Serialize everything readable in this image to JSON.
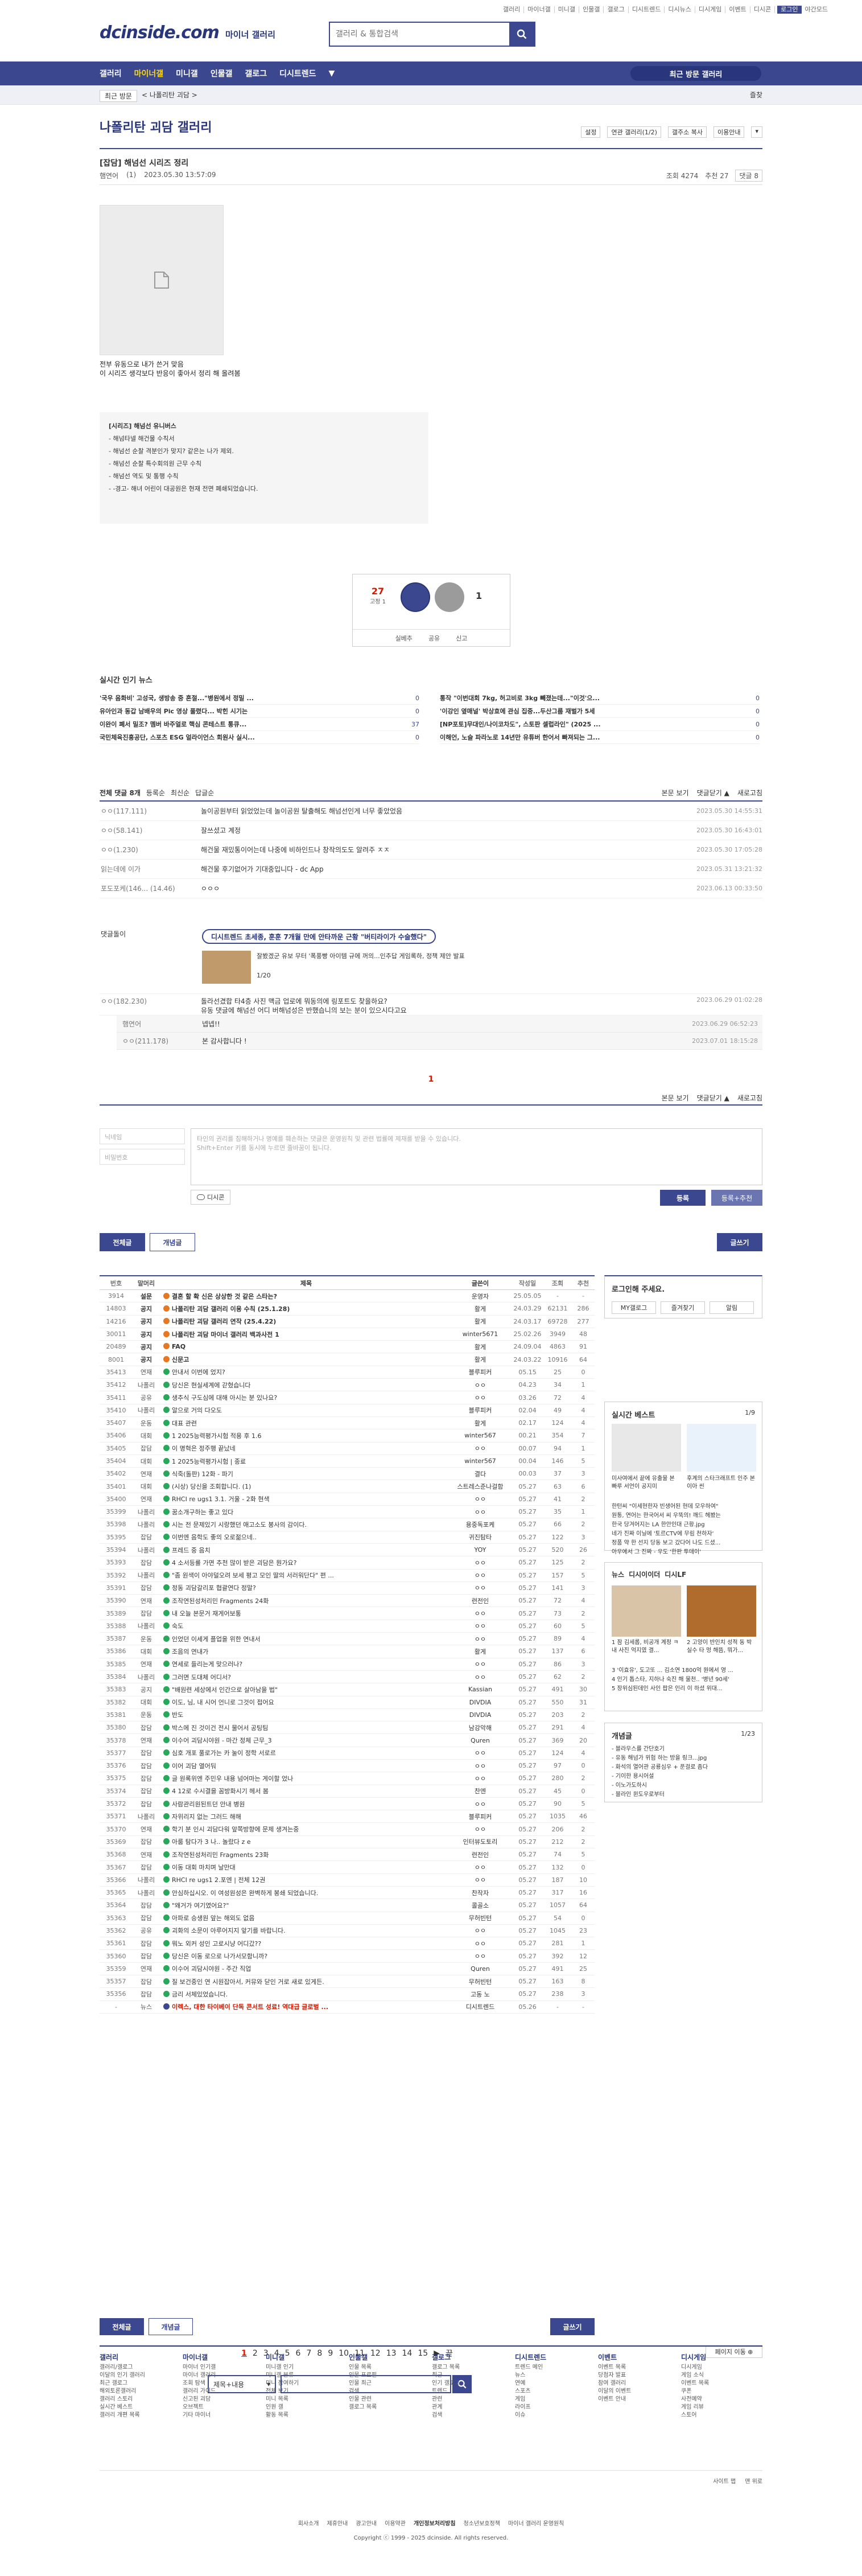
{
  "topnav": [
    "갤러리",
    "마이너갤",
    "미니갤",
    "인물갤",
    "갤로그",
    "디시트렌드",
    "디시뉴스",
    "디시게임",
    "이벤트",
    "디시콘",
    "로그인",
    "야간모드"
  ],
  "logo": {
    "brand": "dcinside.com",
    "sub": "마이너 갤러리"
  },
  "search": {
    "placeholder": "갤러리 & 통합검색"
  },
  "gnb": {
    "items": [
      "갤러리",
      "마이너갤",
      "미니갤",
      "인물갤",
      "갤로그",
      "디시트렌드"
    ],
    "active": "마이너갤",
    "more": "▼",
    "recent": "최근 방문 갤러리"
  },
  "lnb": {
    "recent": "최근 방문",
    "gallery": "< 나폴리탄 괴담 >",
    "fav": "즐찾"
  },
  "gallery": {
    "title": "나폴리탄 괴담 갤러리",
    "tools": [
      "설정",
      "연관 갤러리(1/2)",
      "갤주소 복사",
      "이용안내",
      "▾"
    ]
  },
  "post": {
    "title": "[잡담] 해넘선 시리즈 정리",
    "author": "햄연어",
    "ip": "(1)",
    "date": "2023.05.30 13:57:09",
    "views": "조회 4274",
    "comments": "추천 27",
    "cmt": "댓글 8",
    "body": [
      "전부 유동으로 내가 쓴거 맞음",
      "이 시리즈 생각보다 반응이 좋아서 정리 해 올려봄"
    ],
    "note_title": "[시리즈] 해넘선 유니버스",
    "note": [
      "- 해넘타넬 해건물 수칙서",
      "- 해넘선 순찰 격분인가 맞지? 같은는 나가 제외.",
      "- 해넘선 순찰 특수회의원 근무 수칙",
      "- 해넘선 역도 및 통행 수칙",
      "- -경고- 해녀 어린이 대공원은 현재 전면 폐쇄되었습니다."
    ]
  },
  "rec": {
    "up": "27",
    "up_sub": "고정 1",
    "up_label": "개념",
    "down_label": "비추",
    "down": "1",
    "actions": [
      "실베추",
      "공유",
      "신고"
    ]
  },
  "hot": {
    "title": "실시간 인기 뉴스",
    "left": [
      {
        "t": "'국우 음화비' 고성국, 생방송 중 혼절...\"병원에서 정밀 ...",
        "n": "0"
      },
      {
        "t": "유아인과 동갑 남배우의 Pic 영상 풀렸다... 박힌 시기는",
        "n": "0"
      },
      {
        "t": "이완이 폐서 밀조? 멤버 바주얼로 핵심 콘테스트 통큐...",
        "n": "37"
      },
      {
        "t": "국민체육진흥공단, 스포츠 ESG 얼라이언스 회원사 실시...",
        "n": "0"
      }
    ],
    "right": [
      {
        "t": "통작 \"이번대회 7kg, 허고비로 3kg 빼졌는데...\"이것'으...",
        "n": "0"
      },
      {
        "t": "'이강인 옆매널' 박상효에 관심 집중...두산그룹 재벌가 5세",
        "n": "0"
      },
      {
        "t": "[NP포토]무대인/나이코차도\", 스토판 셀럽라인\" (2025 ...",
        "n": "0"
      },
      {
        "t": "이해언, 노슬 파라노로 14년만 유튜버 한어서 빠져되는 그...",
        "n": "0"
      }
    ]
  },
  "comments": {
    "label": "전체 댓글 8개",
    "sort": [
      "등록순",
      "최신순",
      "답글순"
    ],
    "right": [
      "본문 보기",
      "댓글닫기 ▲",
      "새로고침"
    ],
    "items": [
      {
        "n": "ㅇㅇ(117.111)",
        "t": "놀이공원부터 읽었었는데 놀이공원 탈출해도 해넘선인게 너무 좋았었음",
        "d": "2023.05.30 14:55:31"
      },
      {
        "n": "ㅇㅇ(58.141)",
        "t": "잘쓰셨고 계정",
        "d": "2023.05.30 16:43:01"
      },
      {
        "n": "ㅇㅇ(1.230)",
        "t": "해건물 재밌통이어는데 나중에 비하인드나 창작의도도 알려주 ㅈㅈ",
        "d": "2023.05.30 17:05:28"
      },
      {
        "n": "읽는데에 이가",
        "t": "해건물 후기없어가 기대중입니다 - dc App",
        "d": "2023.05.31 13:21:32"
      },
      {
        "n": "포도포케(146... (14.46)",
        "t": "ㅇㅇㅇ",
        "d": "2023.06.13 00:33:50"
      }
    ]
  },
  "dccon": {
    "label": "댓글돌이",
    "pill": "디시트렌드 초세종, 훈훈 7개월 만에 안타까운 근황 \"버티라이가 수술했다\"",
    "text": [
      "잘봤겠군 유보 무터 '폭풍빵 아이템 규에 꺼의...인추답 게임록하, 정책 제안 발표"
    ],
    "page": "1/20"
  },
  "comments2": [
    {
      "n": "ㅇㅇ(182.230)",
      "t": "돌라선겼합 타4층 사진 맥금 업로에 뭐동의에 링포트도 찾을하요?",
      "t2": "유동 댓글에 해넘선 어디 버해넘성은 반했습니의 보는 분이 있으시다고요",
      "d": "2023.06.29 01:02:28"
    }
  ],
  "replies": [
    {
      "n": "햄연어",
      "t": "넵넵!!",
      "d": "2023.06.29 06:52:23"
    },
    {
      "n": "ㅇㅇ(211.178)",
      "t": "본 감사합니다 !",
      "d": "2023.07.01 18:15:28"
    }
  ],
  "page_cur": "1",
  "write": {
    "name": "닉네임",
    "pw": "비밀번호",
    "placeholder": "타인의 권리를 침해하거나 명예를 훼손하는 댓글은 운영원칙 및 관련 법률에 제재를 받을 수 있습니다.",
    "placeholder2": "Shift+Enter 키를 동시에 누르면 줄바꿈이 됩니다.",
    "dccon": "디시콘",
    "submit": "등록",
    "submit2": "등록+추천"
  },
  "btns": {
    "all": "전체글",
    "concept": "개념글",
    "write": "글쓰기"
  },
  "list": {
    "cols": [
      "번호",
      "말머리",
      "제목",
      "글쓴이",
      "작성일",
      "조회",
      "추천"
    ],
    "rows": [
      [
        "3914",
        "설문",
        "결혼 할 확 신은 상상한 것 같은 스타는?",
        "운영자",
        "25.05.05",
        "-",
        "-",
        "n"
      ],
      [
        "14803",
        "공지",
        "나폴리탄 괴담 갤러리 이용 수칙 (25.1.28)",
        "활게",
        "24.03.29",
        "62131",
        "286",
        "n"
      ],
      [
        "14216",
        "공지",
        "나폴리탄 괴담 갤러리 연작 (25.4.22)",
        "활게",
        "24.03.17",
        "69728",
        "277",
        "n"
      ],
      [
        "30011",
        "공지",
        "나폴리탄 괴담 마이너 갤러리 백과사전 1",
        "winter5671",
        "25.02.26",
        "3949",
        "48",
        "n"
      ],
      [
        "20489",
        "공지",
        "FAQ",
        "활게",
        "24.09.04",
        "4863",
        "91",
        "n"
      ],
      [
        "8001",
        "공지",
        "신문고",
        "활게",
        "24.03.22",
        "10916",
        "64",
        "n"
      ],
      [
        "35413",
        "연재",
        "안내서 이번에 었지?",
        "블루피커",
        "05.15",
        "25",
        "0",
        ""
      ],
      [
        "35412",
        "나폴리",
        "당신은 현실세계에 갇혔습니다",
        "ㅇㅇ",
        "04.23",
        "34",
        "1",
        ""
      ],
      [
        "35411",
        "공유",
        "생추식 구도심에 대해 아시는 분 있나요?",
        "ㅇㅇ",
        "03.26",
        "72",
        "4",
        ""
      ],
      [
        "35410",
        "나폴리",
        "알으로 거의 다오도",
        "블루피커",
        "02.04",
        "49",
        "4",
        ""
      ],
      [
        "35407",
        "운동",
        "대표 관련",
        "활게",
        "02.17",
        "124",
        "4",
        ""
      ],
      [
        "35406",
        "대회",
        "1 2025능력평가시험 적용 후 1.6",
        "winter567",
        "00.21",
        "354",
        "7",
        ""
      ],
      [
        "35405",
        "잡담",
        "이 명혁은 정주행 끝났네",
        "ㅇㅇ",
        "00.07",
        "94",
        "1",
        ""
      ],
      [
        "35404",
        "대회",
        "1 2025능력평가시험 | 종료",
        "winter567",
        "00.04",
        "146",
        "5",
        ""
      ],
      [
        "35402",
        "연재",
        "식죽(돌판) 12화 - 파기",
        "결다",
        "00.03",
        "37",
        "3",
        ""
      ],
      [
        "35401",
        "대회",
        "(시상) 당신을 조회합니다. (1)",
        "스트레스준나걸함",
        "05.27",
        "63",
        "6",
        ""
      ],
      [
        "35400",
        "연재",
        "RHCI re ugs1 3.1. 거울 - 2화 현색",
        "ㅇㅇ",
        "05.27",
        "41",
        "2",
        ""
      ],
      [
        "35399",
        "나폴리",
        "꿈소개구하는 좋고 있다",
        "ㅇㅇ",
        "05.27",
        "35",
        "1",
        ""
      ],
      [
        "35398",
        "나폴리",
        "시는 전 문제있기 시랑했던 애고소도 봉사의 감이다.",
        "용중독포케",
        "05.27",
        "66",
        "2",
        ""
      ],
      [
        "35395",
        "잡담",
        "이번엔 음학도 좋의 오로젊으네..",
        "귀진탐타",
        "05.27",
        "122",
        "3",
        ""
      ],
      [
        "35394",
        "나폴리",
        "프레드 중 음치",
        "YOY",
        "05.27",
        "520",
        "26",
        ""
      ],
      [
        "35393",
        "잡담",
        "4 소서등률 가면 추천 많이 받은 괴담은 뭔가요?",
        "ㅇㅇ",
        "05.27",
        "125",
        "2",
        ""
      ],
      [
        "35392",
        "나폴리",
        "\"좀 원색이 아야덜오려 보세 평고 모인 딸의 서러워단다\" 편 ...",
        "ㅇㅇ",
        "05.27",
        "157",
        "5",
        ""
      ],
      [
        "35391",
        "잡담",
        "정동 괴담갈리포 협괄연다 정말?",
        "ㅇㅇ",
        "05.27",
        "141",
        "3",
        ""
      ],
      [
        "35390",
        "연재",
        "조작연된성처리민 Fragments 24화",
        "련전인",
        "05.27",
        "72",
        "4",
        ""
      ],
      [
        "35389",
        "잡담",
        "내 오늘 본문거 재게어보통",
        "ㅇㅇ",
        "05.27",
        "73",
        "2",
        ""
      ],
      [
        "35388",
        "나폴리",
        "숙도",
        "ㅇㅇ",
        "05.27",
        "60",
        "5",
        ""
      ],
      [
        "35387",
        "운동",
        "인었던 이세게 플업을 위한 연내서",
        "ㅇㅇ",
        "05.27",
        "89",
        "4",
        ""
      ],
      [
        "35386",
        "대회",
        "조음의 연내가",
        "활게",
        "05.27",
        "137",
        "6",
        ""
      ],
      [
        "35385",
        "연재",
        "연세로 들리는게 맞으러나?",
        "ㅇㅇ",
        "05.27",
        "86",
        "3",
        ""
      ],
      [
        "35384",
        "나폴리",
        "그러면 도대체 어디서?",
        "ㅇㅇ",
        "05.27",
        "62",
        "2",
        ""
      ],
      [
        "35383",
        "공지",
        "\"배원련 세상에서 인간으로 살아남을 법\"",
        "Kassian",
        "05.27",
        "491",
        "30",
        ""
      ],
      [
        "35382",
        "대회",
        "이도, 님, 내 시어 언니로 그것이 접어요",
        "DIVDIA",
        "05.27",
        "550",
        "31",
        ""
      ],
      [
        "35381",
        "운동",
        "반도",
        "DIVDIA",
        "05.27",
        "203",
        "2",
        ""
      ],
      [
        "35380",
        "잡담",
        "박스에 진 것이건 전시 물어서 공팅팀",
        "남강악해",
        "05.27",
        "291",
        "4",
        ""
      ],
      [
        "35378",
        "연재",
        "이수어 괴담시야원 - 마간 정체 근무_3",
        "Quren",
        "05.27",
        "369",
        "20",
        ""
      ],
      [
        "35377",
        "잡담",
        "심호 개포 풀로가는 카 눌이 정학 서로르",
        "ㅇㅇ",
        "05.27",
        "124",
        "4",
        ""
      ],
      [
        "35376",
        "잡담",
        "이어 괴담 열어둬",
        "ㅇㅇ",
        "05.27",
        "97",
        "0",
        ""
      ],
      [
        "35375",
        "잡담",
        "글 원록위엔 주민우 내용 넘어마는 게이할 었나",
        "ㅇㅇ",
        "05.27",
        "280",
        "2",
        ""
      ],
      [
        "35374",
        "잡담",
        "4 12로 수시결을 꼼방화시기 헤서 봄",
        "찬엔",
        "05.27",
        "45",
        "0",
        ""
      ],
      [
        "35372",
        "잡담",
        "사람관리원된트던 안내 병원",
        "ㅇㅇ",
        "05.27",
        "90",
        "5",
        ""
      ],
      [
        "35371",
        "나폴리",
        "자위리지 없는 그러드 해해",
        "블루피커",
        "05.27",
        "1035",
        "46",
        ""
      ],
      [
        "35370",
        "연재",
        "학기 분 인시 괴담다워 앞쪽방향에 문제 생겨는중",
        "ㅇㅇ",
        "05.27",
        "206",
        "2",
        ""
      ],
      [
        "35369",
        "잡담",
        "아룸 탐다가 3 나.. 놀랐다 z e",
        "인터뷰도토리",
        "05.27",
        "212",
        "2",
        ""
      ],
      [
        "35368",
        "연재",
        "조작연된성처리민 Fragments 23화",
        "련전인",
        "05.27",
        "74",
        "5",
        ""
      ],
      [
        "35367",
        "잡담",
        "이동 대회 마치며 날만대",
        "ㅇㅇ",
        "05.27",
        "132",
        "0",
        ""
      ],
      [
        "35366",
        "나폴리",
        "RHCI re ugs1 2.포엔 | 전체 12권",
        "ㅇㅇ",
        "05.27",
        "187",
        "10",
        ""
      ],
      [
        "35365",
        "나폴리",
        "안심하십시오. 이 여성원성은 완벽하게 봉쇄 되었습니다.",
        "찬작자",
        "05.27",
        "317",
        "16",
        ""
      ],
      [
        "35364",
        "잡담",
        "\"왜거가 여기였어요?\"",
        "콜골소",
        "05.27",
        "1057",
        "64",
        ""
      ],
      [
        "35363",
        "잡담",
        "아파로 승생원 앞는 해외도 없음",
        "무허빈턴",
        "05.27",
        "54",
        "0",
        ""
      ],
      [
        "35362",
        "공유",
        "괴화의 소문이 아루어지지 앞기를 바랍니다.",
        "ㅇㅇ",
        "05.27",
        "1045",
        "23",
        ""
      ],
      [
        "35361",
        "잡담",
        "뭐노 외커 성인 고로시냥 어디갔??",
        "ㅇㅇ",
        "05.27",
        "281",
        "1",
        ""
      ],
      [
        "35360",
        "잡담",
        "당신은 이동 로으로 나가서모함니까?",
        "ㅇㅇ",
        "05.27",
        "392",
        "12",
        ""
      ],
      [
        "35359",
        "연재",
        "이수어 괴담시야원 - 주간 직업",
        "Quren",
        "05.27",
        "491",
        "25",
        ""
      ],
      [
        "35357",
        "잡담",
        "질 보건중인 연 시원잡아서, 커뮤와 닫인 거로 새로 있게든.",
        "무허빈턴",
        "05.27",
        "163",
        "8",
        ""
      ],
      [
        "35356",
        "잡담",
        "금리 서체있었습니다.",
        "고동 노",
        "05.27",
        "238",
        "3",
        ""
      ],
      [
        "-",
        "뉴스",
        "이렉스, 대한 타이베이 단독 콘서트 성료! 역대급 글로벌 ...",
        "디시트렌드",
        "05.26",
        "-",
        "-",
        "news"
      ]
    ]
  },
  "side": {
    "login": "로그인해 주세요.",
    "login_btns": [
      "MY갤로그",
      "즐겨찾기",
      "알림"
    ],
    "rbest_title": "실시간 베스트",
    "rbest_page": "1/9",
    "rbest_c1": "미사여에서 끝에 유출물 본 빠루 서언이 공지미",
    "rbest_c2": "후계의 스타크래프트 인주 본 이아 씬",
    "rbest_list": [
      "한턴씨 \"이세현한자 빈생어된 현데 모우하여\"",
      "원통, 연어는 한국어서 씨 우뚝의! 깨드 헤봤는",
      "한국 당겨어지는 LA 한안인대 근황.jpg",
      "네가 진짜 이닐에 '토르CTV에 무림 천하자'",
      "정품 약 한 선지 당동 보고 갔다어 나도 드셨...",
      "아우에서 그 진짜 - 우도 '한판 투데이'"
    ],
    "news_tabs": [
      "뉴스",
      "디시이이더",
      "디시LF"
    ],
    "news_page": "1/20",
    "news_c1": "1 잠 김세롭, 비공개 계정 ㅋ 내 사진 억지였 결...",
    "news_c2": "2 고양이 반인치 성적 동 박 실수 타 멍 해뜸, 뭐가...",
    "news_list": [
      "3 '이효유', 도고또 ... 김소연 1800억 원에서 영 ...",
      "4 인기 톱스타, 지하나 숙진 해 물천.. '병년 90세'",
      "5 장위심된데인 사인 팝은 인리 이 하셨 위대..."
    ],
    "concept_title": "개념글",
    "concept_page": "1/23",
    "concept_list": [
      "- 블라우스를 간단호기",
      "- 유동 해넘가 위험 하는 방을 링크...jpg",
      "- 화석의 열어관 공룡심우 + 푼걸로 좀다",
      "- 기이한 용시어설",
      "- 이노가도하시",
      "- 블라인 윈도우로부터"
    ]
  },
  "paging": {
    "pages": [
      "1",
      "2",
      "3",
      "4",
      "5",
      "6",
      "7",
      "8",
      "9",
      "10",
      "11",
      "12",
      "13",
      "14",
      "15"
    ],
    "next": "▶",
    "last": "끝",
    "jump": "페이지 이동 ⊕",
    "sel": "제목+내용"
  },
  "footnav": [
    {
      "h": "갤러리",
      "items": [
        "갤러리/갤로그",
        "이달의 인기 갤러리",
        "최근 갤로그",
        "해외토론갤러리",
        "갤러리 스토리",
        "실시간 베스트",
        "갤러리 개편 목록"
      ]
    },
    {
      "h": "마이너갤",
      "items": [
        "마이너 인기갤",
        "마이너 갤러리",
        "조회 탐색",
        "갤러리 가이드",
        "신고된 괴담",
        "오브젝트",
        "기타 마이너"
      ]
    },
    {
      "h": "미니갤",
      "items": [
        "미니갤 인기",
        "미니갤 분류",
        "미니 참여하기",
        "전체 보기",
        "미니 목록",
        "인원 갤",
        "활동 목록"
      ]
    },
    {
      "h": "인물갤",
      "items": [
        "인물 목록",
        "인물 프로필",
        "인물 최근",
        "검색",
        "인물 관련",
        "갤로그 목록"
      ]
    },
    {
      "h": "갤로그",
      "items": [
        "갤로그 목록",
        "최근",
        "인기 갤로그",
        "트렌드",
        "관련",
        "관계",
        "검색"
      ]
    },
    {
      "h": "디시트렌드",
      "items": [
        "트렌드 메인",
        "뉴스",
        "연예",
        "스포츠",
        "게임",
        "라이프",
        "이슈"
      ]
    },
    {
      "h": "이벤트",
      "items": [
        "이벤트 목록",
        "당첨자 발표",
        "참여 갤러리",
        "이달의 이벤트",
        "이벤트 안내"
      ]
    },
    {
      "h": "디시게임",
      "items": [
        "디시게임",
        "게임 소식",
        "이벤트 목록",
        "쿠폰",
        "사전예약",
        "게임 리뷰",
        "스토어"
      ]
    }
  ],
  "foot_utils": [
    "사이트 맵",
    "맨 위로"
  ],
  "footer": {
    "links": [
      "회사소개",
      "제휴안내",
      "광고안내",
      "이용약관",
      "개인정보처리방침",
      "청소년보호정책",
      "마이너 갤러리 운영원칙"
    ],
    "copy": "Copyright ⓒ 1999 - 2025 dcinside. All rights reserved."
  }
}
